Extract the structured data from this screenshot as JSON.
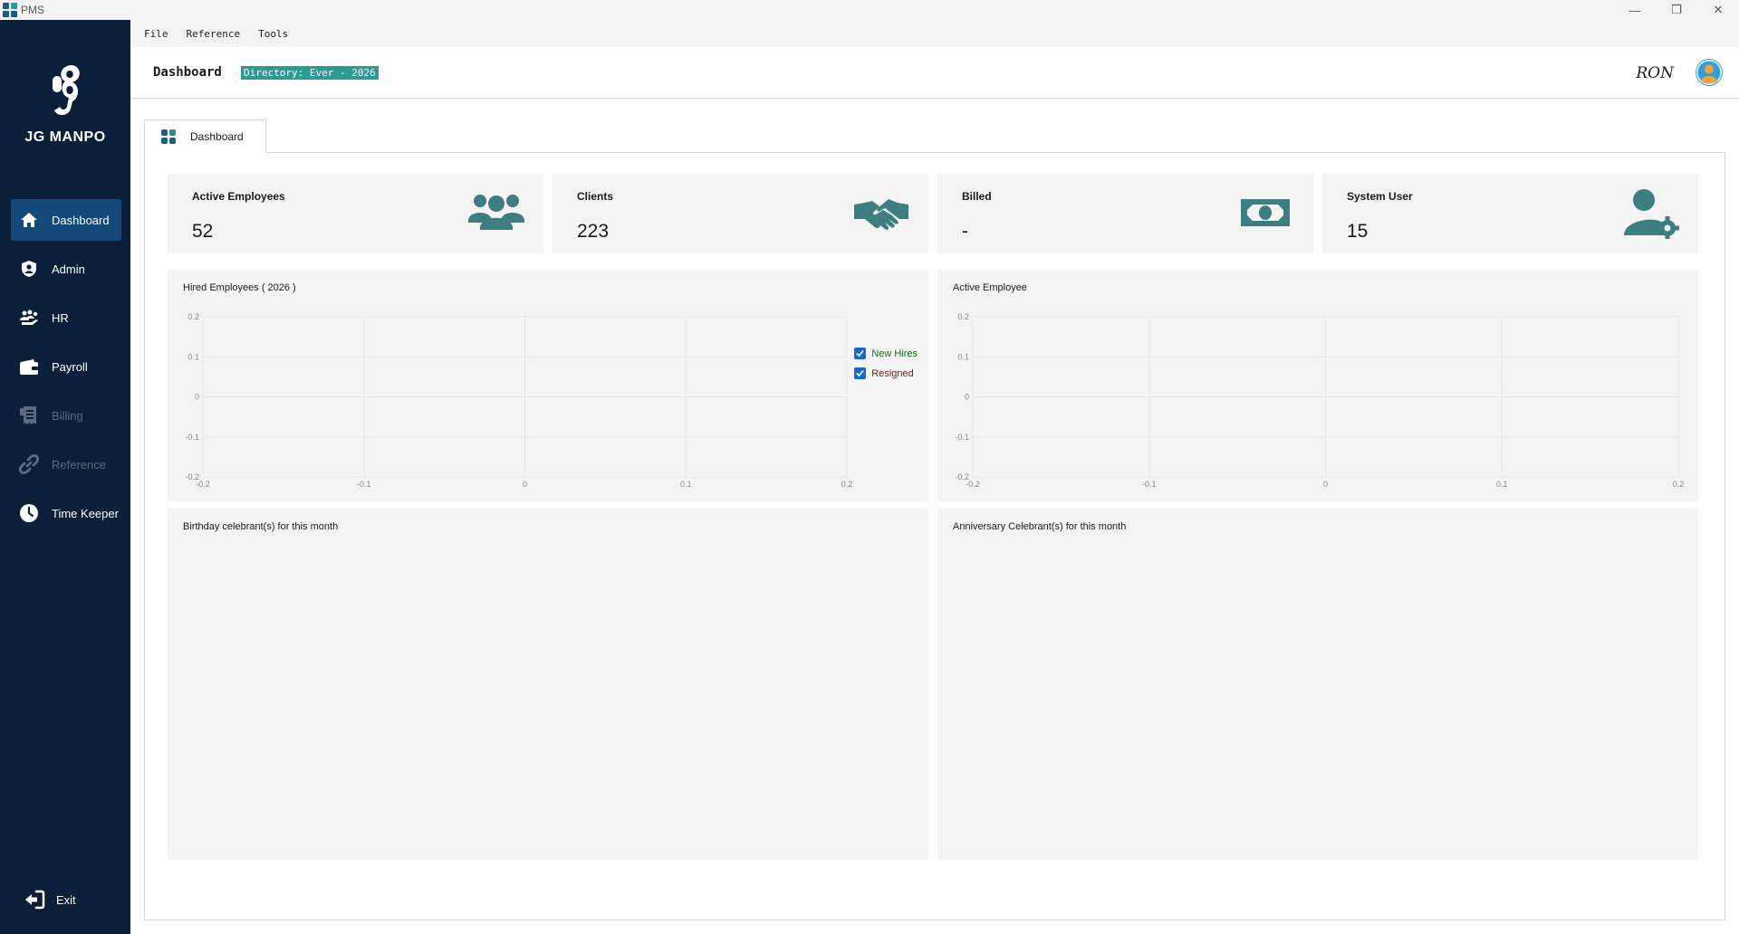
{
  "window": {
    "title": "PMS"
  },
  "brand": {
    "name": "JG MANPO"
  },
  "menu": [
    {
      "label": "File"
    },
    {
      "label": "Reference"
    },
    {
      "label": "Tools"
    }
  ],
  "header": {
    "title": "Dashboard",
    "directory": "Directory: Ever - 2026",
    "user": "RON"
  },
  "sidebar": {
    "items": [
      {
        "label": "Dashboard",
        "icon": "home-icon",
        "active": true
      },
      {
        "label": "Admin",
        "icon": "shield-user-icon"
      },
      {
        "label": "HR",
        "icon": "people-icon"
      },
      {
        "label": "Payroll",
        "icon": "wallet-icon"
      },
      {
        "label": "Billing",
        "icon": "receipt-icon",
        "disabled": true
      },
      {
        "label": "Reference",
        "icon": "link-icon",
        "disabled": true
      },
      {
        "label": "Time Keeper",
        "icon": "clock-icon"
      }
    ],
    "exit": "Exit"
  },
  "tabs": [
    {
      "label": "Dashboard"
    }
  ],
  "cards": [
    {
      "title": "Active Employees",
      "value": "52",
      "icon": "users-icon"
    },
    {
      "title": "Clients",
      "value": "223",
      "icon": "handshake-icon"
    },
    {
      "title": "Billed",
      "value": "-",
      "icon": "money-bill-icon"
    },
    {
      "title": "System User",
      "value": "15",
      "icon": "user-gear-icon"
    }
  ],
  "panels": {
    "hired": {
      "title": "Hired Employees ( 2026 )"
    },
    "active": {
      "title": "Active Employee"
    },
    "birthday": {
      "title": "Birthday celebrant(s) for this month"
    },
    "anniversary": {
      "title": "Anniversary Celebrant(s) for this month"
    }
  },
  "chart_data": [
    {
      "type": "line",
      "title": "Hired Employees ( 2026 )",
      "x_ticks": [
        "-0.2",
        "-0.1",
        "0",
        "0.1",
        "0.2"
      ],
      "y_ticks": [
        "0.2",
        "0.1",
        "0",
        "-0.1",
        "-0.2"
      ],
      "xlim": [
        -0.2,
        0.2
      ],
      "ylim": [
        -0.2,
        0.2
      ],
      "grid": true,
      "legend": "right",
      "series": [
        {
          "name": "New Hires",
          "values": [],
          "color": "#1b6b1b"
        },
        {
          "name": "Resigned",
          "values": [],
          "color": "#7a1a1a"
        }
      ]
    },
    {
      "type": "line",
      "title": "Active Employee",
      "x_ticks": [
        "-0.2",
        "-0.1",
        "0",
        "0.1",
        "0.2"
      ],
      "y_ticks": [
        "0.2",
        "0.1",
        "0",
        "-0.1",
        "-0.2"
      ],
      "xlim": [
        -0.2,
        0.2
      ],
      "ylim": [
        -0.2,
        0.2
      ],
      "grid": true,
      "series": []
    }
  ],
  "colors": {
    "sidebar": "#0c1f38",
    "active_nav": "#15497a",
    "accent": "#2e9a94",
    "icon_teal": "#3d7f80"
  }
}
